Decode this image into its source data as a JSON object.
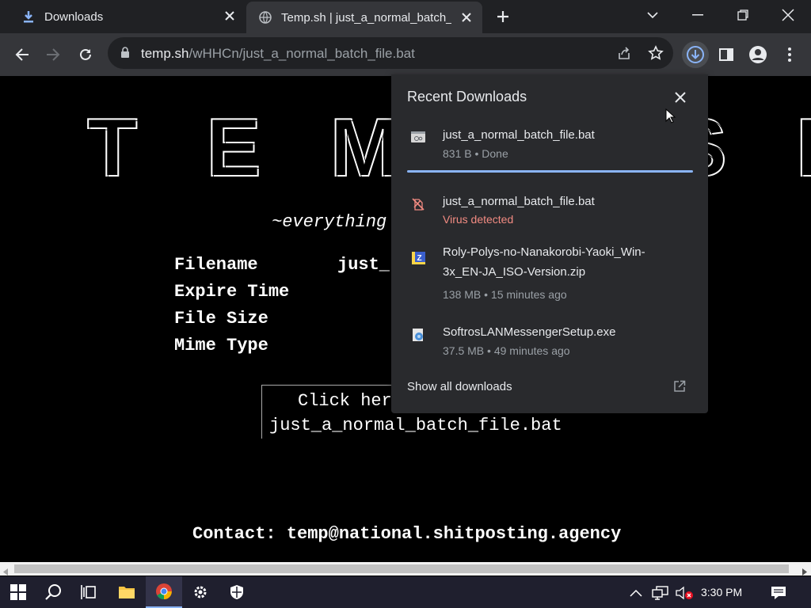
{
  "tabs": [
    {
      "title": "Downloads",
      "icon": "download-icon"
    },
    {
      "title": "Temp.sh | just_a_normal_batch_file.bat",
      "icon": "globe-icon"
    }
  ],
  "toolbar": {
    "url_host": "temp.sh",
    "url_path": "/wHHCn/just_a_normal_batch_file.bat"
  },
  "page": {
    "logo_text": "TEMP.SH",
    "tagline": "~everything",
    "rows": [
      {
        "label": "Filename",
        "value": "just_"
      },
      {
        "label": "Expire Time",
        "value": ""
      },
      {
        "label": "File Size",
        "value": ""
      },
      {
        "label": "Mime Type",
        "value": ""
      }
    ],
    "click_line1": "Click here",
    "click_line2": "just_a_normal_batch_file.bat",
    "contact": "Contact: temp@national.shitposting.agency"
  },
  "downloads": {
    "title": "Recent Downloads",
    "items": [
      {
        "name": "just_a_normal_batch_file.bat",
        "status": "831 B • Done",
        "icon": "batch-file-icon",
        "state": "done"
      },
      {
        "name": "just_a_normal_batch_file.bat",
        "status": "Virus detected",
        "icon": "blocked-file-icon",
        "state": "danger"
      },
      {
        "name": "Roly-Polys-no-Nanakorobi-Yaoki_Win-3x_EN-JA_ISO-Version.zip",
        "status": "138 MB • 15 minutes ago",
        "icon": "zip-file-icon",
        "state": "done"
      },
      {
        "name": "SoftrosLANMessengerSetup.exe",
        "status": "37.5 MB • 49 minutes ago",
        "icon": "installer-icon",
        "state": "done"
      }
    ],
    "show_all": "Show all downloads"
  },
  "taskbar": {
    "time": "3:30 PM"
  },
  "colors": {
    "tab_bg": "#202124",
    "toolbar_bg": "#35363a",
    "accent": "#8ab4f8",
    "danger": "#f28b82"
  }
}
